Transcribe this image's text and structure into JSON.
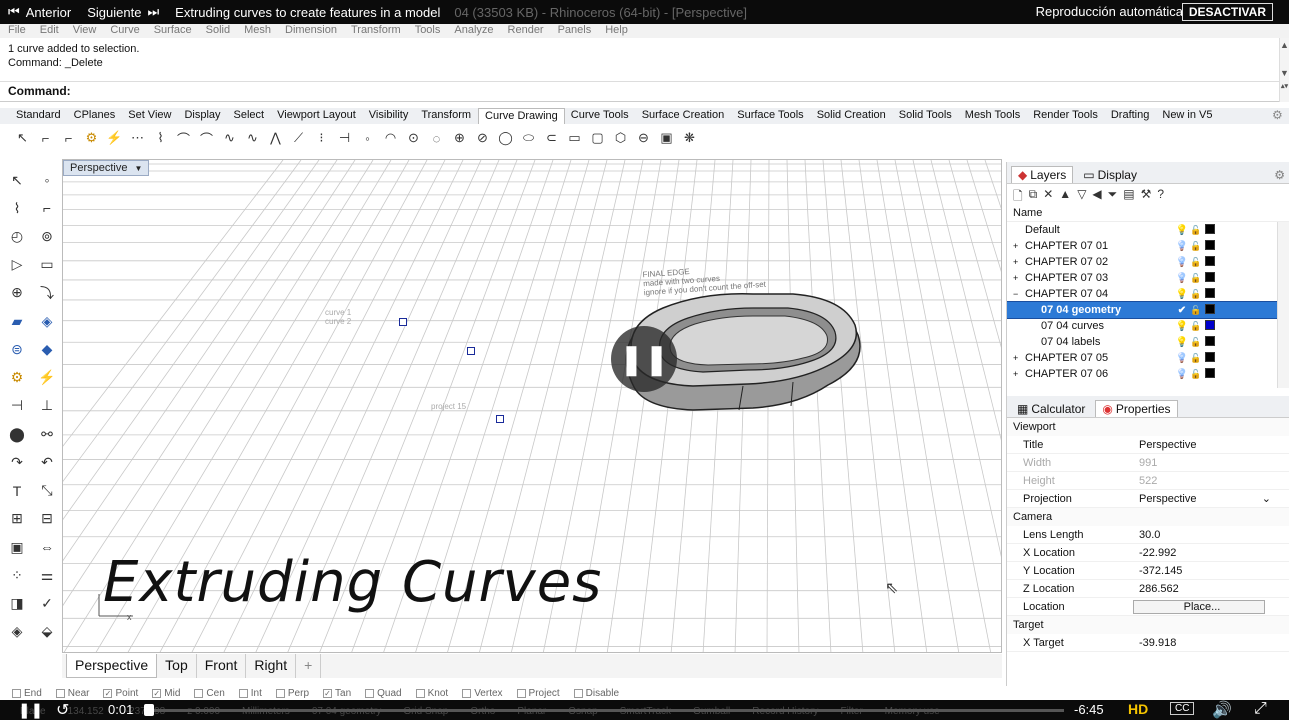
{
  "video": {
    "prev_label": "Anterior",
    "next_label": "Siguiente",
    "title": "Extruding curves to create features in a model",
    "window_title_ghost": "04  (33503 KB) - Rhinoceros (64-bit) - [Perspective]",
    "autoplay_label": "Reproducción automática",
    "deactivate_label": "DESACTIVAR",
    "time_current": "0:01",
    "time_remaining": "-6:45",
    "progress": 0.003,
    "hd_label": "HD",
    "cc_label": "CC",
    "overlay_title": "Extruding Curves"
  },
  "menu": [
    "File",
    "Edit",
    "View",
    "Curve",
    "Surface",
    "Solid",
    "Mesh",
    "Dimension",
    "Transform",
    "Tools",
    "Analyze",
    "Render",
    "Panels",
    "Help"
  ],
  "command_history": [
    "1 curve added to selection.",
    "Command: _Delete"
  ],
  "command_prompt": "Command:",
  "toolbar_tabs": [
    "Standard",
    "CPlanes",
    "Set View",
    "Display",
    "Select",
    "Viewport Layout",
    "Visibility",
    "Transform",
    "Curve Drawing",
    "Curve Tools",
    "Surface Creation",
    "Surface Tools",
    "Solid Creation",
    "Solid Tools",
    "Mesh Tools",
    "Render Tools",
    "Drafting",
    "New in V5"
  ],
  "toolbar_active": "Curve Drawing",
  "viewport": {
    "label": "Perspective",
    "tabs": [
      "Perspective",
      "Top",
      "Front",
      "Right"
    ],
    "add_tab": "+",
    "grid_text": [
      "FINAL EDGE",
      "made with two curves",
      "ignore if you don't count the off-set",
      "curve 1",
      "curve 2",
      "project 15"
    ]
  },
  "osnap": [
    {
      "label": "End",
      "checked": false
    },
    {
      "label": "Near",
      "checked": false
    },
    {
      "label": "Point",
      "checked": true
    },
    {
      "label": "Mid",
      "checked": true
    },
    {
      "label": "Cen",
      "checked": false
    },
    {
      "label": "Int",
      "checked": false
    },
    {
      "label": "Perp",
      "checked": false
    },
    {
      "label": "Tan",
      "checked": true
    },
    {
      "label": "Quad",
      "checked": false
    },
    {
      "label": "Knot",
      "checked": false
    },
    {
      "label": "Vertex",
      "checked": false
    },
    {
      "label": "Project",
      "checked": false
    },
    {
      "label": "Disable",
      "checked": false
    }
  ],
  "status_ghost": [
    "Plane",
    "134.152",
    "-237.098",
    "z 0.000",
    "Millimeters",
    "07 04 geometry",
    "Grid Snap",
    "Ortho",
    "Planar",
    "Osnap",
    "SmartTrack",
    "Gumball",
    "Record History",
    "Filter",
    "Memory use"
  ],
  "layers_panel": {
    "tabs": [
      "Layers",
      "Display"
    ],
    "column_name": "Name",
    "rows": [
      {
        "name": "Default",
        "indent": 0,
        "expand": "",
        "sel": false,
        "swatch": "#000000",
        "bulb": "on"
      },
      {
        "name": "CHAPTER 07 01",
        "indent": 0,
        "expand": "+",
        "sel": false,
        "swatch": "#000000",
        "bulb": "blue"
      },
      {
        "name": "CHAPTER 07 02",
        "indent": 0,
        "expand": "+",
        "sel": false,
        "swatch": "#000000",
        "bulb": "blue"
      },
      {
        "name": "CHAPTER 07 03",
        "indent": 0,
        "expand": "+",
        "sel": false,
        "swatch": "#000000",
        "bulb": "blue"
      },
      {
        "name": "CHAPTER 07 04",
        "indent": 0,
        "expand": "−",
        "sel": false,
        "swatch": "#000000",
        "bulb": "on"
      },
      {
        "name": "07 04 geometry",
        "indent": 1,
        "expand": "",
        "sel": true,
        "swatch": "#000000",
        "bulb": "check"
      },
      {
        "name": "07 04 curves",
        "indent": 1,
        "expand": "",
        "sel": false,
        "swatch": "#0000cc",
        "bulb": "on"
      },
      {
        "name": "07 04 labels",
        "indent": 1,
        "expand": "",
        "sel": false,
        "swatch": "#000000",
        "bulb": "on"
      },
      {
        "name": "CHAPTER 07 05",
        "indent": 0,
        "expand": "+",
        "sel": false,
        "swatch": "#000000",
        "bulb": "blue"
      },
      {
        "name": "CHAPTER 07 06",
        "indent": 0,
        "expand": "+",
        "sel": false,
        "swatch": "#000000",
        "bulb": "blue"
      }
    ]
  },
  "properties_panel": {
    "tabs": [
      "Calculator",
      "Properties"
    ],
    "section_viewport": "Viewport",
    "viewport_rows": [
      {
        "k": "Title",
        "v": "Perspective",
        "disabled": false
      },
      {
        "k": "Width",
        "v": "991",
        "disabled": true
      },
      {
        "k": "Height",
        "v": "522",
        "disabled": true
      },
      {
        "k": "Projection",
        "v": "Perspective",
        "disabled": false
      }
    ],
    "section_camera": "Camera",
    "camera_rows": [
      {
        "k": "Lens Length",
        "v": "30.0"
      },
      {
        "k": "X Location",
        "v": "-22.992"
      },
      {
        "k": "Y Location",
        "v": "-372.145"
      },
      {
        "k": "Z Location",
        "v": "286.562"
      },
      {
        "k": "Location",
        "v": "Place..."
      }
    ],
    "section_target": "Target",
    "target_rows": [
      {
        "k": "X Target",
        "v": "-39.918"
      }
    ]
  }
}
